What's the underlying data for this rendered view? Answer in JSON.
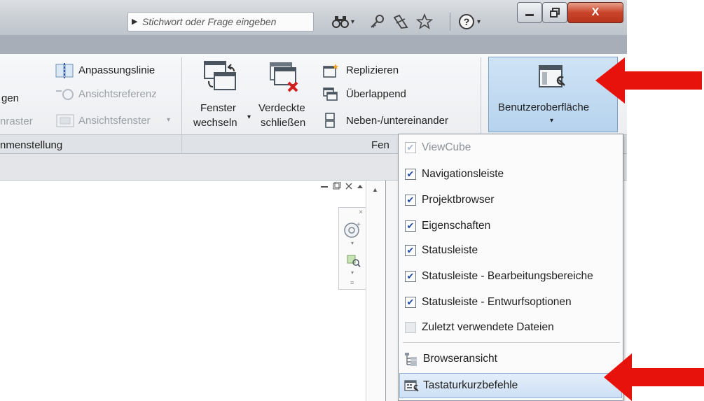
{
  "titlebar": {
    "search_placeholder": "Stichwort oder Frage eingeben",
    "icons": [
      "binoculars-icon",
      "key-icon",
      "satellite-icon",
      "star-icon",
      "help-icon"
    ],
    "window_buttons": [
      "minimize",
      "restore",
      "close"
    ],
    "close_label": "X"
  },
  "ribbon": {
    "left_group": {
      "partial_labels": [
        "gen",
        "nraster"
      ],
      "items": [
        {
          "label": "Anpassungslinie",
          "icon": "matchline-icon",
          "enabled": true
        },
        {
          "label": "Ansichtsreferenz",
          "icon": "view-reference-icon",
          "enabled": false
        },
        {
          "label": "Ansichtsfenster",
          "icon": "viewport-icon",
          "enabled": false,
          "has_dropdown": true
        }
      ],
      "panel_title": "nmenstellung"
    },
    "window_group": {
      "big_buttons": [
        {
          "line1": "Fenster",
          "line2": "wechseln",
          "icon": "switch-windows-icon",
          "has_dropdown": true
        },
        {
          "line1": "Verdeckte",
          "line2": "schließen",
          "icon": "close-hidden-icon"
        }
      ],
      "small_buttons": [
        {
          "label": "Replizieren",
          "icon": "replicate-icon"
        },
        {
          "label": "Überlappend",
          "icon": "cascade-icon"
        },
        {
          "label": "Neben-/untereinander",
          "icon": "tile-icon"
        }
      ],
      "panel_title": "Fen"
    },
    "ui_button": {
      "label": "Benutzeroberfläche",
      "icon": "user-interface-icon",
      "has_dropdown": true,
      "active": true
    }
  },
  "menu": {
    "checked_items": [
      {
        "label": "ViewCube",
        "checked": true,
        "enabled": false
      },
      {
        "label": "Navigationsleiste",
        "checked": true,
        "enabled": true
      },
      {
        "label": "Projektbrowser",
        "checked": true,
        "enabled": true
      },
      {
        "label": "Eigenschaften",
        "checked": true,
        "enabled": true
      },
      {
        "label": "Statusleiste",
        "checked": true,
        "enabled": true
      },
      {
        "label": "Statusleiste - Bearbeitungsbereiche",
        "checked": true,
        "enabled": true
      },
      {
        "label": "Statusleiste - Entwurfsoptionen",
        "checked": true,
        "enabled": true
      },
      {
        "label": "Zuletzt verwendete Dateien",
        "checked": false,
        "enabled": true
      }
    ],
    "command_items": [
      {
        "label": "Browseransicht",
        "icon": "browser-organization-icon",
        "highlighted": false
      },
      {
        "label": "Tastaturkurzbefehle",
        "icon": "keyboard-shortcuts-icon",
        "highlighted": true
      }
    ]
  },
  "annotations": {
    "arrow_color": "#e8120c",
    "accent_color": "#1f4aa8",
    "highlight_color": "#b6d3ee"
  }
}
